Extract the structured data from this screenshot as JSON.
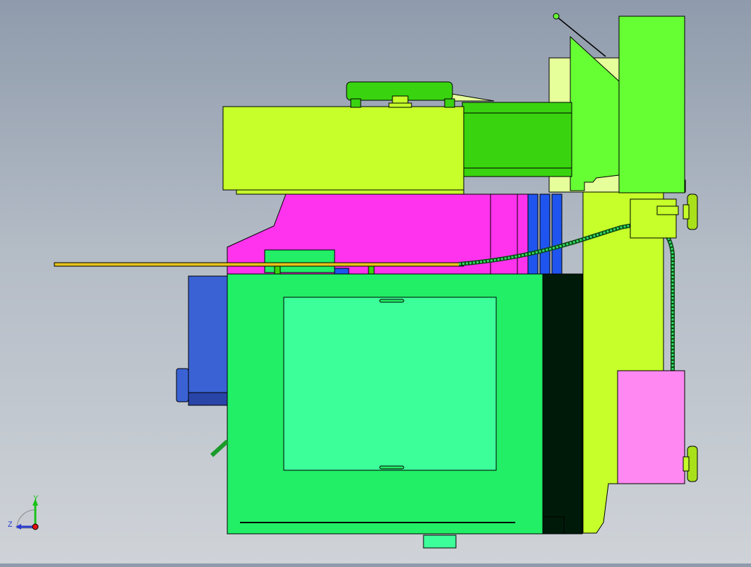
{
  "triad": {
    "y_label": "Y",
    "z_label": "Z",
    "colors": {
      "y_axis": "#19c219",
      "z_axis": "#2a3cd0",
      "x_axis": "#e01010"
    }
  },
  "model": {
    "colors": {
      "lime": "#c6ff2a",
      "lime_dark": "#a8e01a",
      "green_bright": "#66ff33",
      "green_mid": "#39d40f",
      "green_body": "#22ee66",
      "green_panel": "#3dff9a",
      "magenta": "#ff33ee",
      "pink": "#ff88f2",
      "blue": "#3a62d4",
      "blue_bright": "#1f55ee",
      "dark": "#001a0a",
      "rod": "#e6c21a",
      "cable": "#33dd66",
      "light_yellow": "#e6ff9a"
    }
  }
}
